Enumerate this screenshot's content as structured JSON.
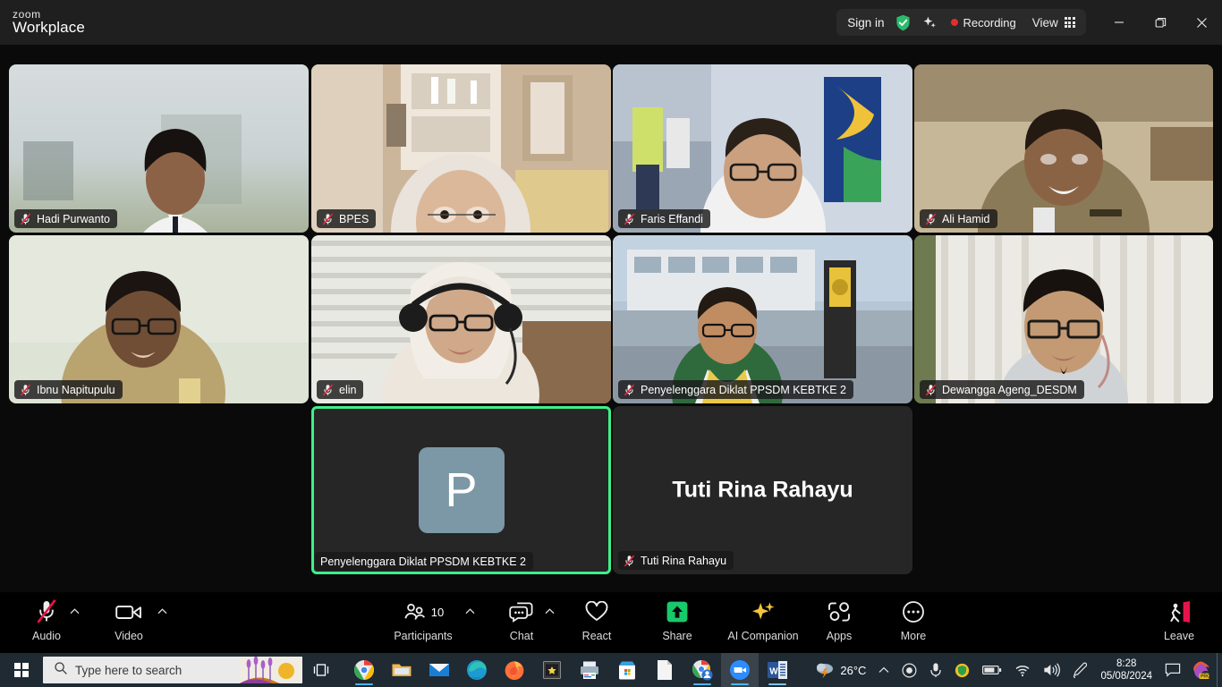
{
  "app": {
    "logo_top": "zoom",
    "logo_bottom": "Workplace"
  },
  "titlebar": {
    "sign_in_label": "Sign in",
    "shield_icon": "verified-shield-icon",
    "sparkle_icon": "ai-sparkle-icon",
    "recording_label": "Recording",
    "recording_dot_color": "#e02f2f",
    "view_label": "View",
    "view_grid_icon": "grid-view-icon",
    "minimize_icon": "minimize-icon",
    "restore_icon": "restore-icon",
    "close_icon": "close-icon"
  },
  "participants": [
    {
      "name": "Hadi Purwanto",
      "muted": true,
      "video": true,
      "speaking": false
    },
    {
      "name": "BPES",
      "muted": true,
      "video": true,
      "speaking": false
    },
    {
      "name": "Faris Effandi",
      "muted": true,
      "video": true,
      "speaking": false
    },
    {
      "name": "Ali Hamid",
      "muted": true,
      "video": true,
      "speaking": false
    },
    {
      "name": "Ibnu Napitupulu",
      "muted": true,
      "video": true,
      "speaking": false
    },
    {
      "name": "elin",
      "muted": true,
      "video": true,
      "speaking": false
    },
    {
      "name": "Penyelenggara Diklat PPSDM KEBTKE 2",
      "muted": true,
      "video": true,
      "speaking": false
    },
    {
      "name": "Dewangga Ageng_DESDM",
      "muted": true,
      "video": true,
      "speaking": false
    },
    {
      "name": "Penyelenggara Diklat PPSDM KEBTKE 2",
      "muted": false,
      "video": false,
      "speaking": true,
      "avatar_letter": "P"
    },
    {
      "name": "Tuti Rina Rahayu",
      "muted": true,
      "video": false,
      "speaking": false,
      "display_name_large": "Tuti Rina Rahayu"
    }
  ],
  "speaking_border_color": "#3ef08c",
  "toolbar": {
    "audio": {
      "label": "Audio",
      "icon": "mic-muted-icon",
      "has_caret": true,
      "muted": true
    },
    "video": {
      "label": "Video",
      "icon": "camera-icon",
      "has_caret": true
    },
    "participants": {
      "label": "Participants",
      "icon": "people-icon",
      "count": "10",
      "has_caret": true
    },
    "chat": {
      "label": "Chat",
      "icon": "chat-bubble-icon",
      "has_caret": true
    },
    "react": {
      "label": "React",
      "icon": "heart-icon"
    },
    "share": {
      "label": "Share",
      "icon": "share-screen-icon",
      "accent": "#18c96a"
    },
    "ai_companion": {
      "label": "AI Companion",
      "icon": "ai-sparkle-icon",
      "accent": "#f5c33b"
    },
    "apps": {
      "label": "Apps",
      "icon": "apps-icon"
    },
    "more": {
      "label": "More",
      "icon": "more-ellipsis-icon"
    },
    "leave": {
      "label": "Leave",
      "icon": "leave-door-icon",
      "accent": "#e8134b"
    }
  },
  "taskbar": {
    "start_icon": "windows-start-icon",
    "search_placeholder": "Type here to search",
    "search_icon": "magnifier-icon",
    "task_view_icon": "task-view-icon",
    "apps": [
      {
        "name": "chrome-icon",
        "running": true
      },
      {
        "name": "file-explorer-icon",
        "running": false
      },
      {
        "name": "mail-icon",
        "running": false
      },
      {
        "name": "edge-icon",
        "running": false
      },
      {
        "name": "firefox-icon",
        "running": false
      },
      {
        "name": "archive-icon",
        "running": false
      },
      {
        "name": "printer-icon",
        "running": false
      },
      {
        "name": "microsoft-store-icon",
        "running": false
      },
      {
        "name": "document-icon",
        "running": false
      },
      {
        "name": "chrome-profile-icon",
        "running": true
      },
      {
        "name": "zoom-icon",
        "running": true,
        "active": true
      },
      {
        "name": "word-icon",
        "running": true
      }
    ],
    "tray": {
      "weather_icon": "weather-cloud-lightning-icon",
      "temperature": "26°C",
      "overflow_icon": "chevron-up-icon",
      "record_icon": "record-circle-icon",
      "mic_icon": "microphone-icon",
      "security_icon": "security-shield-icon",
      "battery_icon": "battery-icon",
      "wifi_icon": "wifi-icon",
      "volume_icon": "volume-icon",
      "pen_icon": "pen-icon",
      "time": "8:28",
      "date": "05/08/2024",
      "notification_icon": "notification-icon",
      "copilot_icon": "copilot-pro-icon"
    }
  }
}
